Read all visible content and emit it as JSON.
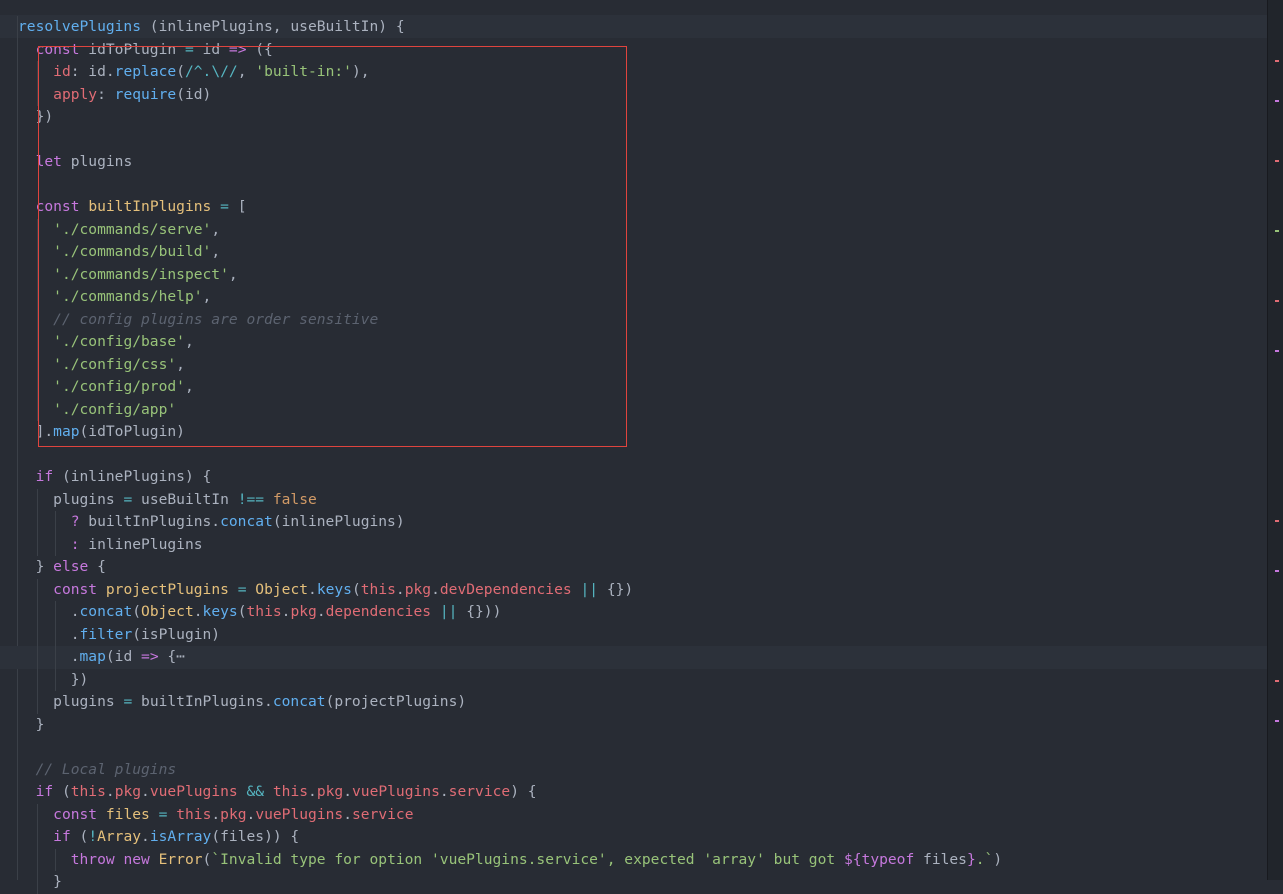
{
  "editor": {
    "lines": [
      {
        "indent": 0,
        "tokens": [
          [
            "f",
            "resolvePlugins"
          ],
          [
            "p",
            " (inlinePlugins, useBuiltIn) {"
          ]
        ]
      },
      {
        "indent": 1,
        "tokens": [
          [
            "k",
            "const"
          ],
          [
            "p",
            " idToPlugin "
          ],
          [
            "o",
            "="
          ],
          [
            "p",
            " id "
          ],
          [
            "k",
            "=>"
          ],
          [
            "p",
            " ({"
          ]
        ]
      },
      {
        "indent": 2,
        "tokens": [
          [
            "v",
            "id"
          ],
          [
            "p",
            ": id."
          ],
          [
            "f",
            "replace"
          ],
          [
            "p",
            "("
          ],
          [
            "r",
            "/^.\\//"
          ],
          [
            "p",
            ", "
          ],
          [
            "s",
            "'built-in:'"
          ],
          [
            "p",
            "),"
          ]
        ]
      },
      {
        "indent": 2,
        "tokens": [
          [
            "v",
            "apply"
          ],
          [
            "p",
            ": "
          ],
          [
            "f",
            "require"
          ],
          [
            "p",
            "(id)"
          ]
        ]
      },
      {
        "indent": 1,
        "tokens": [
          [
            "p",
            "})"
          ]
        ]
      },
      {
        "indent": 0,
        "tokens": []
      },
      {
        "indent": 1,
        "tokens": [
          [
            "k",
            "let"
          ],
          [
            "p",
            " plugins"
          ]
        ]
      },
      {
        "indent": 0,
        "tokens": []
      },
      {
        "indent": 1,
        "tokens": [
          [
            "k",
            "const"
          ],
          [
            "p",
            " "
          ],
          [
            "t",
            "builtInPlugins"
          ],
          [
            "p",
            " "
          ],
          [
            "o",
            "="
          ],
          [
            "p",
            " ["
          ]
        ]
      },
      {
        "indent": 2,
        "tokens": [
          [
            "s",
            "'./commands/serve'"
          ],
          [
            "p",
            ","
          ]
        ]
      },
      {
        "indent": 2,
        "tokens": [
          [
            "s",
            "'./commands/build'"
          ],
          [
            "p",
            ","
          ]
        ]
      },
      {
        "indent": 2,
        "tokens": [
          [
            "s",
            "'./commands/inspect'"
          ],
          [
            "p",
            ","
          ]
        ]
      },
      {
        "indent": 2,
        "tokens": [
          [
            "s",
            "'./commands/help'"
          ],
          [
            "p",
            ","
          ]
        ]
      },
      {
        "indent": 2,
        "tokens": [
          [
            "c",
            "// config plugins are order sensitive"
          ]
        ]
      },
      {
        "indent": 2,
        "tokens": [
          [
            "s",
            "'./config/base'"
          ],
          [
            "p",
            ","
          ]
        ]
      },
      {
        "indent": 2,
        "tokens": [
          [
            "s",
            "'./config/css'"
          ],
          [
            "p",
            ","
          ]
        ]
      },
      {
        "indent": 2,
        "tokens": [
          [
            "s",
            "'./config/prod'"
          ],
          [
            "p",
            ","
          ]
        ]
      },
      {
        "indent": 2,
        "tokens": [
          [
            "s",
            "'./config/app'"
          ]
        ]
      },
      {
        "indent": 1,
        "tokens": [
          [
            "p",
            "]."
          ],
          [
            "f",
            "map"
          ],
          [
            "p",
            "(idToPlugin)"
          ]
        ]
      },
      {
        "indent": 0,
        "tokens": []
      },
      {
        "indent": 1,
        "tokens": [
          [
            "k",
            "if"
          ],
          [
            "p",
            " (inlinePlugins) {"
          ]
        ]
      },
      {
        "indent": 2,
        "tokens": [
          [
            "p",
            "plugins "
          ],
          [
            "o",
            "="
          ],
          [
            "p",
            " useBuiltIn "
          ],
          [
            "o",
            "!=="
          ],
          [
            "p",
            " "
          ],
          [
            "n",
            "false"
          ]
        ]
      },
      {
        "indent": 3,
        "tokens": [
          [
            "k",
            "?"
          ],
          [
            "p",
            " builtInPlugins."
          ],
          [
            "f",
            "concat"
          ],
          [
            "p",
            "(inlinePlugins)"
          ]
        ]
      },
      {
        "indent": 3,
        "tokens": [
          [
            "k",
            ":"
          ],
          [
            "p",
            " inlinePlugins"
          ]
        ]
      },
      {
        "indent": 1,
        "tokens": [
          [
            "p",
            "} "
          ],
          [
            "k",
            "else"
          ],
          [
            "p",
            " {"
          ]
        ]
      },
      {
        "indent": 2,
        "tokens": [
          [
            "k",
            "const"
          ],
          [
            "p",
            " "
          ],
          [
            "t",
            "projectPlugins"
          ],
          [
            "p",
            " "
          ],
          [
            "o",
            "="
          ],
          [
            "p",
            " "
          ],
          [
            "t",
            "Object"
          ],
          [
            "p",
            "."
          ],
          [
            "f",
            "keys"
          ],
          [
            "p",
            "("
          ],
          [
            "v",
            "this"
          ],
          [
            "p",
            "."
          ],
          [
            "v",
            "pkg"
          ],
          [
            "p",
            "."
          ],
          [
            "v",
            "devDependencies"
          ],
          [
            "p",
            " "
          ],
          [
            "o",
            "||"
          ],
          [
            "p",
            " {})"
          ]
        ]
      },
      {
        "indent": 3,
        "tokens": [
          [
            "p",
            "."
          ],
          [
            "f",
            "concat"
          ],
          [
            "p",
            "("
          ],
          [
            "t",
            "Object"
          ],
          [
            "p",
            "."
          ],
          [
            "f",
            "keys"
          ],
          [
            "p",
            "("
          ],
          [
            "v",
            "this"
          ],
          [
            "p",
            "."
          ],
          [
            "v",
            "pkg"
          ],
          [
            "p",
            "."
          ],
          [
            "v",
            "dependencies"
          ],
          [
            "p",
            " "
          ],
          [
            "o",
            "||"
          ],
          [
            "p",
            " {}))"
          ]
        ]
      },
      {
        "indent": 3,
        "tokens": [
          [
            "p",
            "."
          ],
          [
            "f",
            "filter"
          ],
          [
            "p",
            "(isPlugin)"
          ]
        ]
      },
      {
        "indent": 3,
        "hl": true,
        "tokens": [
          [
            "p",
            "."
          ],
          [
            "f",
            "map"
          ],
          [
            "p",
            "(id "
          ],
          [
            "k",
            "=>"
          ],
          [
            "p",
            " {⋯"
          ]
        ]
      },
      {
        "indent": 3,
        "tokens": [
          [
            "p",
            "})"
          ]
        ]
      },
      {
        "indent": 2,
        "tokens": [
          [
            "p",
            "plugins "
          ],
          [
            "o",
            "="
          ],
          [
            "p",
            " builtInPlugins."
          ],
          [
            "f",
            "concat"
          ],
          [
            "p",
            "(projectPlugins)"
          ]
        ]
      },
      {
        "indent": 1,
        "tokens": [
          [
            "p",
            "}"
          ]
        ]
      },
      {
        "indent": 0,
        "tokens": []
      },
      {
        "indent": 1,
        "tokens": [
          [
            "c",
            "// Local plugins"
          ]
        ]
      },
      {
        "indent": 1,
        "tokens": [
          [
            "k",
            "if"
          ],
          [
            "p",
            " ("
          ],
          [
            "v",
            "this"
          ],
          [
            "p",
            "."
          ],
          [
            "v",
            "pkg"
          ],
          [
            "p",
            "."
          ],
          [
            "v",
            "vuePlugins"
          ],
          [
            "p",
            " "
          ],
          [
            "o",
            "&&"
          ],
          [
            "p",
            " "
          ],
          [
            "v",
            "this"
          ],
          [
            "p",
            "."
          ],
          [
            "v",
            "pkg"
          ],
          [
            "p",
            "."
          ],
          [
            "v",
            "vuePlugins"
          ],
          [
            "p",
            "."
          ],
          [
            "v",
            "service"
          ],
          [
            "p",
            ") {"
          ]
        ]
      },
      {
        "indent": 2,
        "tokens": [
          [
            "k",
            "const"
          ],
          [
            "p",
            " "
          ],
          [
            "t",
            "files"
          ],
          [
            "p",
            " "
          ],
          [
            "o",
            "="
          ],
          [
            "p",
            " "
          ],
          [
            "v",
            "this"
          ],
          [
            "p",
            "."
          ],
          [
            "v",
            "pkg"
          ],
          [
            "p",
            "."
          ],
          [
            "v",
            "vuePlugins"
          ],
          [
            "p",
            "."
          ],
          [
            "v",
            "service"
          ]
        ]
      },
      {
        "indent": 2,
        "tokens": [
          [
            "k",
            "if"
          ],
          [
            "p",
            " ("
          ],
          [
            "o",
            "!"
          ],
          [
            "t",
            "Array"
          ],
          [
            "p",
            "."
          ],
          [
            "f",
            "isArray"
          ],
          [
            "p",
            "(files)) {"
          ]
        ]
      },
      {
        "indent": 3,
        "tokens": [
          [
            "k",
            "throw"
          ],
          [
            "p",
            " "
          ],
          [
            "k",
            "new"
          ],
          [
            "p",
            " "
          ],
          [
            "t",
            "Error"
          ],
          [
            "p",
            "("
          ],
          [
            "s",
            "`Invalid type for option 'vuePlugins.service', expected 'array' but got "
          ],
          [
            "k",
            "${"
          ],
          [
            "k",
            "typeof"
          ],
          [
            "p",
            " files"
          ],
          [
            "k",
            "}"
          ],
          [
            "s",
            ".`"
          ],
          [
            "p",
            ")"
          ]
        ]
      },
      {
        "indent": 2,
        "tokens": [
          [
            "p",
            "}"
          ]
        ]
      }
    ]
  }
}
